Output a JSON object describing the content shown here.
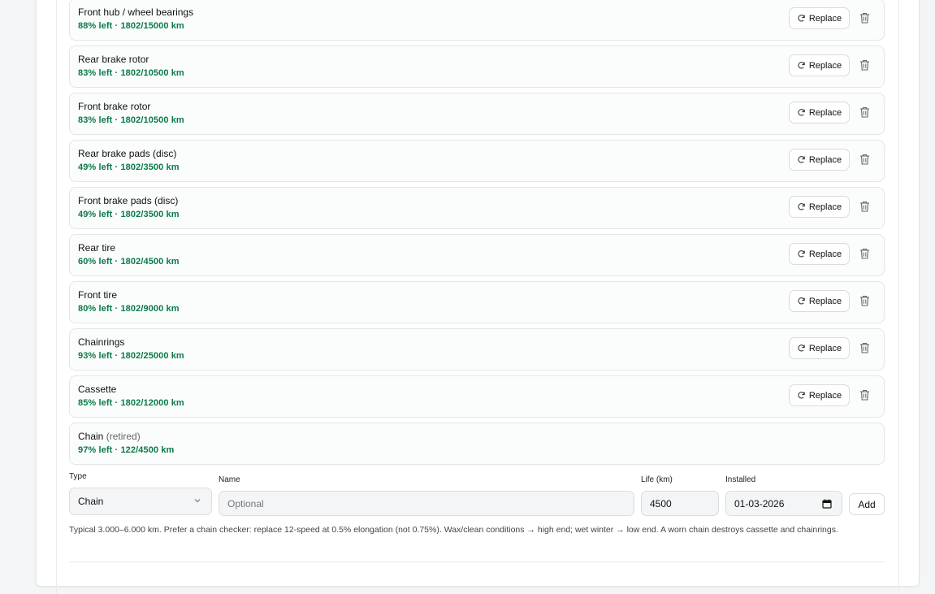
{
  "components": [
    {
      "name": "Front hub / wheel bearings",
      "status": "88% left · 1802/15000 km",
      "retired": false
    },
    {
      "name": "Rear brake rotor",
      "status": "83% left · 1802/10500 km",
      "retired": false
    },
    {
      "name": "Front brake rotor",
      "status": "83% left · 1802/10500 km",
      "retired": false
    },
    {
      "name": "Rear brake pads (disc)",
      "status": "49% left · 1802/3500 km",
      "retired": false
    },
    {
      "name": "Front brake pads (disc)",
      "status": "49% left · 1802/3500 km",
      "retired": false
    },
    {
      "name": "Rear tire",
      "status": "60% left · 1802/4500 km",
      "retired": false
    },
    {
      "name": "Front tire",
      "status": "80% left · 1802/9000 km",
      "retired": false
    },
    {
      "name": "Chainrings",
      "status": "93% left · 1802/25000 km",
      "retired": false
    },
    {
      "name": "Cassette",
      "status": "85% left · 1802/12000 km",
      "retired": false
    },
    {
      "name": "Chain",
      "status": "97% left · 122/4500 km",
      "retired": true,
      "retired_label": "(retired)"
    }
  ],
  "actions": {
    "replace_label": "Replace"
  },
  "form": {
    "type_label": "Type",
    "type_value": "Chain",
    "name_label": "Name",
    "name_placeholder": "Optional",
    "life_label": "Life (km)",
    "life_value": "4500",
    "installed_label": "Installed",
    "installed_value": "01-03-2026",
    "add_label": "Add",
    "hint": "Typical 3.000–6.000 km. Prefer a chain checker: replace 12-speed at 0.5% elongation (not 0.75%). Wax/clean conditions → high end; wet winter → low end. A worn chain destroys cassette and chainrings."
  },
  "colors": {
    "status_green": "#0b7a4b"
  },
  "icons": {
    "replace": "refresh-icon",
    "delete": "trash-icon",
    "select": "chevron-down-icon",
    "date": "calendar-icon"
  }
}
